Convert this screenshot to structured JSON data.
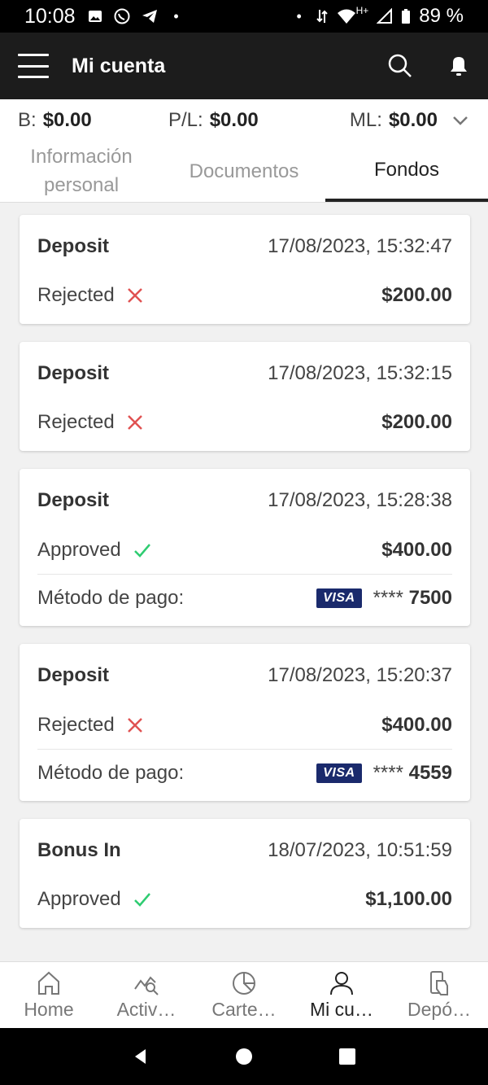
{
  "status_bar": {
    "time": "10:08",
    "network": "H+",
    "battery": "89 %"
  },
  "header": {
    "title": "Mi cuenta"
  },
  "balances": [
    {
      "label": "B:",
      "value": "$0.00"
    },
    {
      "label": "P/L:",
      "value": "$0.00"
    },
    {
      "label": "ML:",
      "value": "$0.00"
    }
  ],
  "tabs": [
    {
      "label": "Información personal",
      "active": false
    },
    {
      "label": "Documentos",
      "active": false
    },
    {
      "label": "Fondos",
      "active": true
    }
  ],
  "transactions": [
    {
      "type": "Deposit",
      "datetime": "17/08/2023, 15:32:47",
      "status": "Rejected",
      "amount": "$200.00"
    },
    {
      "type": "Deposit",
      "datetime": "17/08/2023, 15:32:15",
      "status": "Rejected",
      "amount": "$200.00"
    },
    {
      "type": "Deposit",
      "datetime": "17/08/2023, 15:28:38",
      "status": "Approved",
      "amount": "$400.00",
      "payment_label": "Método de pago:",
      "card_brand": "VISA",
      "card_mask": "****",
      "card_last4": "7500"
    },
    {
      "type": "Deposit",
      "datetime": "17/08/2023, 15:20:37",
      "status": "Rejected",
      "amount": "$400.00",
      "payment_label": "Método de pago:",
      "card_brand": "VISA",
      "card_mask": "****",
      "card_last4": "4559"
    },
    {
      "type": "Bonus In",
      "datetime": "18/07/2023, 10:51:59",
      "status": "Approved",
      "amount": "$1,100.00"
    }
  ],
  "bottom_nav": [
    {
      "label": "Home",
      "icon": "home-icon"
    },
    {
      "label": "Activ…",
      "icon": "activity-chart-icon"
    },
    {
      "label": "Carte…",
      "icon": "pie-chart-icon"
    },
    {
      "label": "Mi cu…",
      "icon": "user-icon",
      "active": true
    },
    {
      "label": "Depó…",
      "icon": "deposit-icon"
    }
  ],
  "colors": {
    "rejected": "#e05252",
    "approved": "#2ecc71",
    "app_bar": "#1c1c1c",
    "visa": "#1a2a6c"
  }
}
